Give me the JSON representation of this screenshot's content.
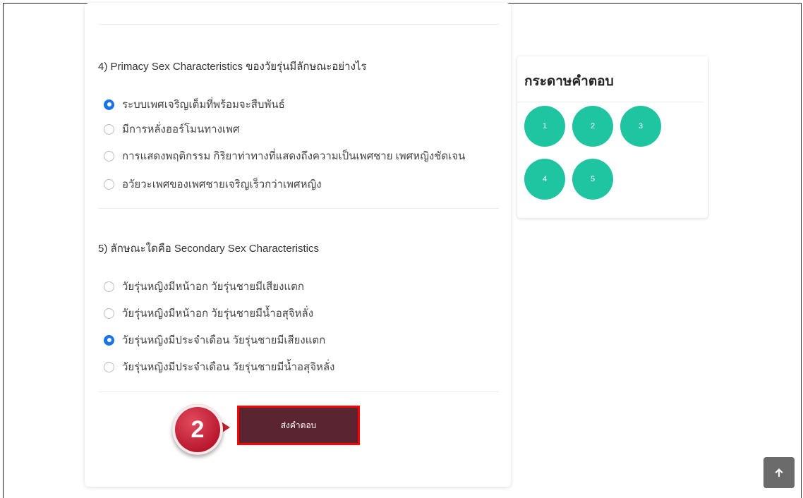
{
  "questions": [
    {
      "text": "4) Primacy Sex Characteristics ของวัยรุ่นมีลักษณะอย่างไร",
      "choices": [
        "ระบบเพศเจริญเต็มที่พร้อมจะสืบพันธ์",
        "มีการหลั่งฮอร์โมนทางเพศ",
        "การแสดงพฤติกรรม กิริยาท่าทางที่แสดงถึงความเป็นเพศชาย เพศหญิงชัดเจน",
        "อวัยวะเพศของเพศชายเจริญเร็วกว่าเพศหญิง"
      ],
      "selected_index": 0
    },
    {
      "text": "5) ลักษณะใดคือ Secondary Sex Characteristics",
      "choices": [
        "วัยรุ่นหญิงมีหน้าอก วัยรุ่นชายมีเสียงแตก",
        "วัยรุ่นหญิงมีหน้าอก วัยรุ่นชายมีน้ำอสุจิหลั่ง",
        "วัยรุ่นหญิงมีประจำเดือน วัยรุ่นชายมีเสียงแตก",
        "วัยรุ่นหญิงมีประจำเดือน วัยรุ่นชายมีน้ำอสุจิหลั่ง"
      ],
      "selected_index": 2
    }
  ],
  "submit_label": "ส่งคำตอบ",
  "step_badge": "2",
  "answer_sheet": {
    "title": "กระดาษคำตอบ",
    "numbers": [
      "1",
      "2",
      "3",
      "4",
      "5"
    ]
  },
  "scroll_top_icon": "arrow-up-icon",
  "colors": {
    "accent_teal": "#1fc4a0",
    "submit_bg": "#5a2430",
    "highlight_border": "#ff0000",
    "radio_checked": "#1a73e8",
    "badge": "#c21f33"
  }
}
